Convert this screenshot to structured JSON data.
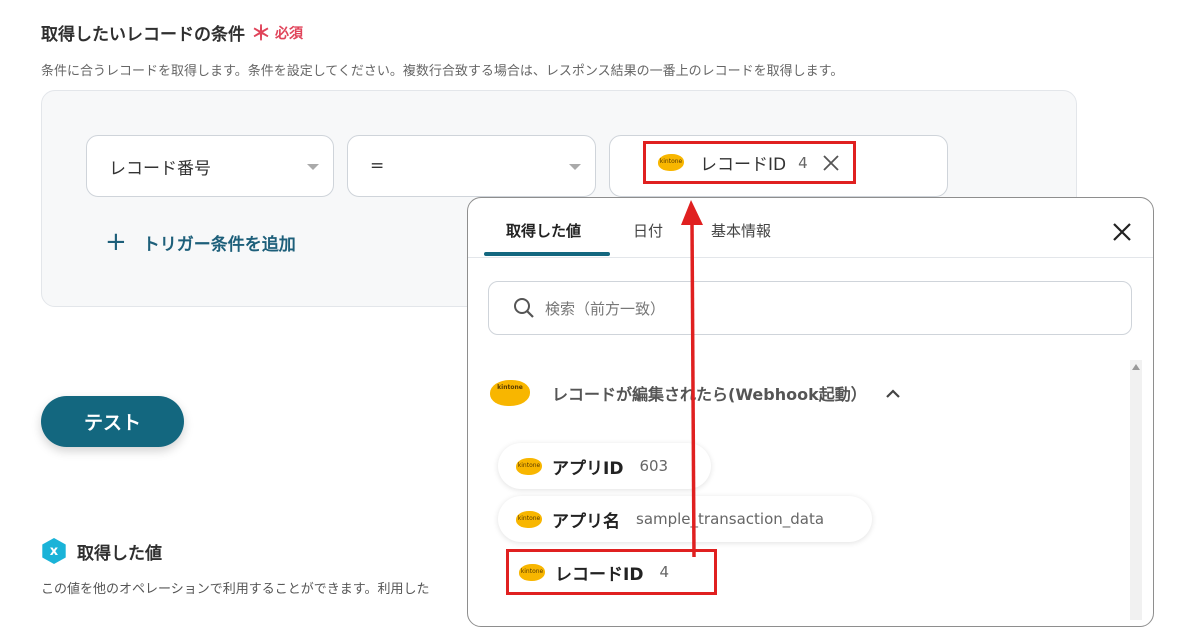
{
  "section": {
    "title": "取得したいレコードの条件",
    "required_mark": "＊",
    "required_label": "必須",
    "description": "条件に合うレコードを取得します。条件を設定してください。複数行合致する場合は、レスポンス結果の一番上のレコードを取得します。"
  },
  "condition": {
    "field_value": "レコード番号",
    "operator_value": "=",
    "chip_label": "レコードID",
    "chip_value": "4",
    "add_label": "トリガー条件を追加"
  },
  "test_button": "テスト",
  "output": {
    "title": "取得した値",
    "icon_letter": "x",
    "description": "この値を他のオペレーションで利用することができます。利用した"
  },
  "popup": {
    "tabs": [
      "取得した値",
      "日付",
      "基本情報"
    ],
    "search_placeholder": "検索（前方一致）",
    "group_label": "レコードが編集されたら(Webhook起動）",
    "items": [
      {
        "label": "アプリID",
        "value": "603"
      },
      {
        "label": "アプリ名",
        "value": "sample_transaction_data"
      },
      {
        "label": "レコードID",
        "value": "4"
      }
    ]
  },
  "colors": {
    "accent": "#13677f",
    "required": "#e0445a",
    "highlight": "#e02020",
    "kintone": "#f8b600"
  },
  "icons": [
    "plus-icon",
    "close-icon",
    "search-icon",
    "chevron-up-icon",
    "kintone-logo-icon",
    "variable-hex-icon"
  ]
}
